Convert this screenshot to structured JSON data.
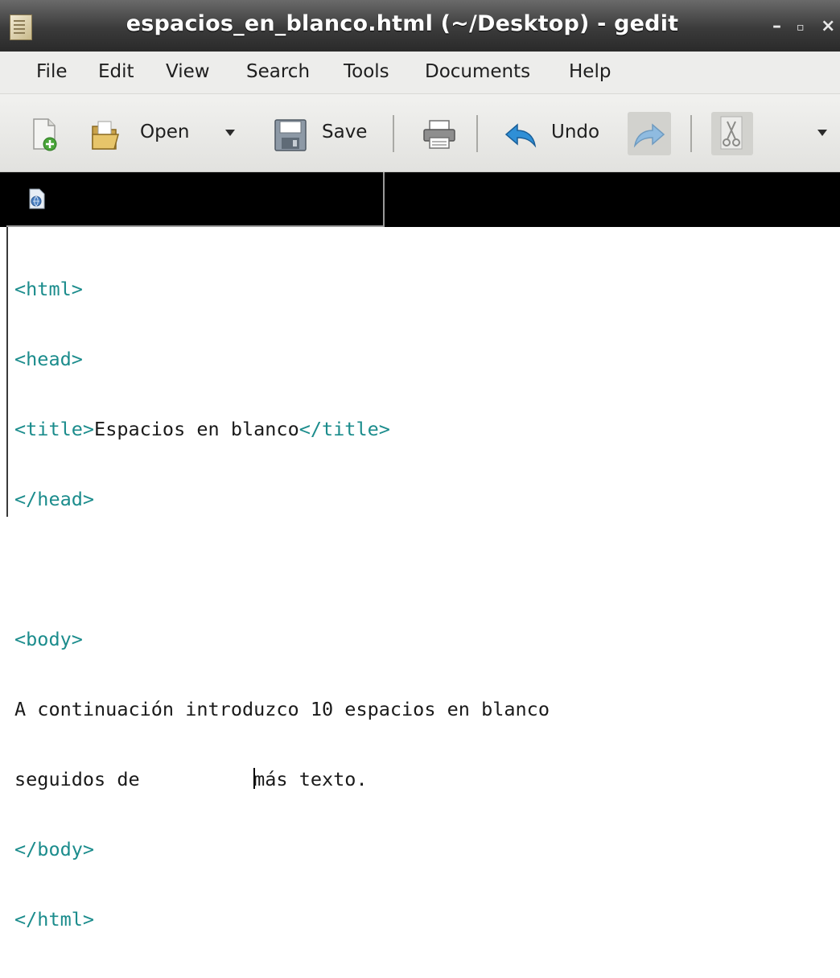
{
  "window": {
    "title": "espacios_en_blanco.html (~/Desktop) - gedit",
    "controls": {
      "minimize": "–",
      "maximize": "▫",
      "close": "×"
    }
  },
  "menu": {
    "items": [
      "File",
      "Edit",
      "View",
      "Search",
      "Tools",
      "Documents",
      "Help"
    ]
  },
  "toolbar": {
    "open_label": "Open",
    "save_label": "Save",
    "undo_label": "Undo",
    "icons": [
      "new-document-icon",
      "open-folder-icon",
      "dropdown-arrow-icon",
      "save-icon",
      "print-icon",
      "undo-icon",
      "redo-icon",
      "cut-icon",
      "overflow-arrow-icon"
    ]
  },
  "tabs": {
    "active_icon": "html-document-icon"
  },
  "editor": {
    "lines": [
      {
        "tag": "<html>"
      },
      {
        "tag": "<head>"
      },
      {
        "tag_open": "<title>",
        "text": "Espacios en blanco",
        "tag_close": "</title>"
      },
      {
        "tag": "</head>"
      },
      {
        "blank": ""
      },
      {
        "tag": "<body>"
      },
      {
        "text": "A continuación introduzco 10 espacios en blanco"
      },
      {
        "text_before_cursor": "seguidos de          ",
        "text_after_cursor": "más texto."
      },
      {
        "tag": "</body>"
      },
      {
        "tag": "</html>"
      }
    ]
  },
  "colors": {
    "tag": "#1b8c8c",
    "text": "#1a1a1a",
    "titlebar": "#3b3b3b",
    "menubar": "#ededeb",
    "tabbar": "#000000"
  }
}
